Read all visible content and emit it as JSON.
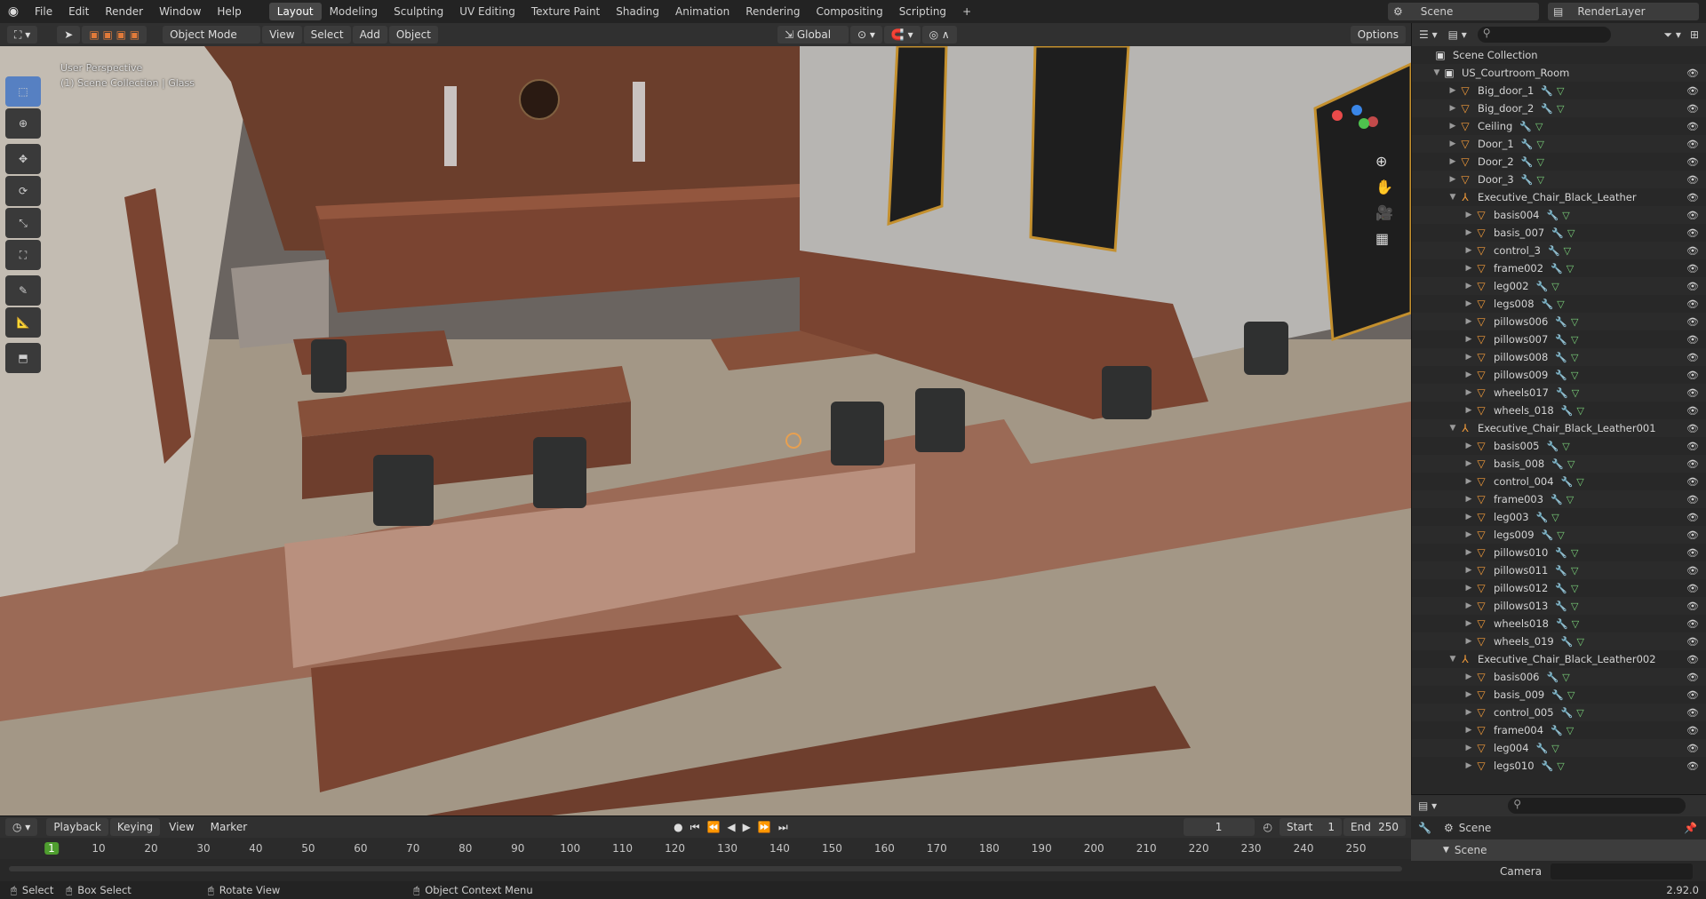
{
  "menus": [
    "File",
    "Edit",
    "Render",
    "Window",
    "Help"
  ],
  "workspaces": [
    "Layout",
    "Modeling",
    "Sculpting",
    "UV Editing",
    "Texture Paint",
    "Shading",
    "Animation",
    "Rendering",
    "Compositing",
    "Scripting"
  ],
  "scene_name": "Scene",
  "render_layer": "RenderLayer",
  "viewport": {
    "mode": "Object Mode",
    "menus": [
      "View",
      "Select",
      "Add",
      "Object"
    ],
    "transform_orientation": "Global",
    "options_label": "Options",
    "overlay_text_1": "User Perspective",
    "overlay_text_2": "(1) Scene Collection | Glass"
  },
  "outliner": {
    "root": "Scene Collection",
    "rows": [
      {
        "label": "US_Courtroom_Room",
        "level": 1,
        "type": "collection",
        "expanded": true
      },
      {
        "label": "Big_door_1",
        "level": 2,
        "type": "mesh"
      },
      {
        "label": "Big_door_2",
        "level": 2,
        "type": "mesh"
      },
      {
        "label": "Ceiling",
        "level": 2,
        "type": "mesh"
      },
      {
        "label": "Door_1",
        "level": 2,
        "type": "mesh"
      },
      {
        "label": "Door_2",
        "level": 2,
        "type": "mesh"
      },
      {
        "label": "Door_3",
        "level": 2,
        "type": "mesh"
      },
      {
        "label": "Executive_Chair_Black_Leather",
        "level": 2,
        "type": "empty",
        "expanded": true
      },
      {
        "label": "basis004",
        "level": 3,
        "type": "mesh"
      },
      {
        "label": "basis_007",
        "level": 3,
        "type": "mesh"
      },
      {
        "label": "control_3",
        "level": 3,
        "type": "mesh"
      },
      {
        "label": "frame002",
        "level": 3,
        "type": "mesh"
      },
      {
        "label": "leg002",
        "level": 3,
        "type": "mesh"
      },
      {
        "label": "legs008",
        "level": 3,
        "type": "mesh"
      },
      {
        "label": "pillows006",
        "level": 3,
        "type": "mesh"
      },
      {
        "label": "pillows007",
        "level": 3,
        "type": "mesh"
      },
      {
        "label": "pillows008",
        "level": 3,
        "type": "mesh"
      },
      {
        "label": "pillows009",
        "level": 3,
        "type": "mesh"
      },
      {
        "label": "wheels017",
        "level": 3,
        "type": "mesh"
      },
      {
        "label": "wheels_018",
        "level": 3,
        "type": "mesh"
      },
      {
        "label": "Executive_Chair_Black_Leather001",
        "level": 2,
        "type": "empty",
        "expanded": true
      },
      {
        "label": "basis005",
        "level": 3,
        "type": "mesh"
      },
      {
        "label": "basis_008",
        "level": 3,
        "type": "mesh"
      },
      {
        "label": "control_004",
        "level": 3,
        "type": "mesh"
      },
      {
        "label": "frame003",
        "level": 3,
        "type": "mesh"
      },
      {
        "label": "leg003",
        "level": 3,
        "type": "mesh"
      },
      {
        "label": "legs009",
        "level": 3,
        "type": "mesh"
      },
      {
        "label": "pillows010",
        "level": 3,
        "type": "mesh"
      },
      {
        "label": "pillows011",
        "level": 3,
        "type": "mesh"
      },
      {
        "label": "pillows012",
        "level": 3,
        "type": "mesh"
      },
      {
        "label": "pillows013",
        "level": 3,
        "type": "mesh"
      },
      {
        "label": "wheels018",
        "level": 3,
        "type": "mesh"
      },
      {
        "label": "wheels_019",
        "level": 3,
        "type": "mesh"
      },
      {
        "label": "Executive_Chair_Black_Leather002",
        "level": 2,
        "type": "empty",
        "expanded": true
      },
      {
        "label": "basis006",
        "level": 3,
        "type": "mesh"
      },
      {
        "label": "basis_009",
        "level": 3,
        "type": "mesh"
      },
      {
        "label": "control_005",
        "level": 3,
        "type": "mesh"
      },
      {
        "label": "frame004",
        "level": 3,
        "type": "mesh"
      },
      {
        "label": "leg004",
        "level": 3,
        "type": "mesh"
      },
      {
        "label": "legs010",
        "level": 3,
        "type": "mesh"
      }
    ]
  },
  "properties": {
    "context": "Scene",
    "panel_title": "Scene",
    "camera_label": "Camera"
  },
  "timeline": {
    "menus": [
      "Playback",
      "Keying",
      "View",
      "Marker"
    ],
    "current_frame": "1",
    "start_label": "Start",
    "start_value": "1",
    "end_label": "End",
    "end_value": "250",
    "ticks": [
      "1",
      "10",
      "20",
      "30",
      "40",
      "50",
      "60",
      "70",
      "80",
      "90",
      "100",
      "110",
      "120",
      "130",
      "140",
      "150",
      "160",
      "170",
      "180",
      "190",
      "200",
      "210",
      "220",
      "230",
      "240",
      "250"
    ]
  },
  "statusbar": {
    "items": [
      "Select",
      "Box Select",
      "Rotate View",
      "Object Context Menu"
    ],
    "version": "2.92.0"
  },
  "colors": {
    "accent": "#5680c2",
    "active_frame": "#4f9e2f",
    "object_orange": "#f29b3a"
  }
}
